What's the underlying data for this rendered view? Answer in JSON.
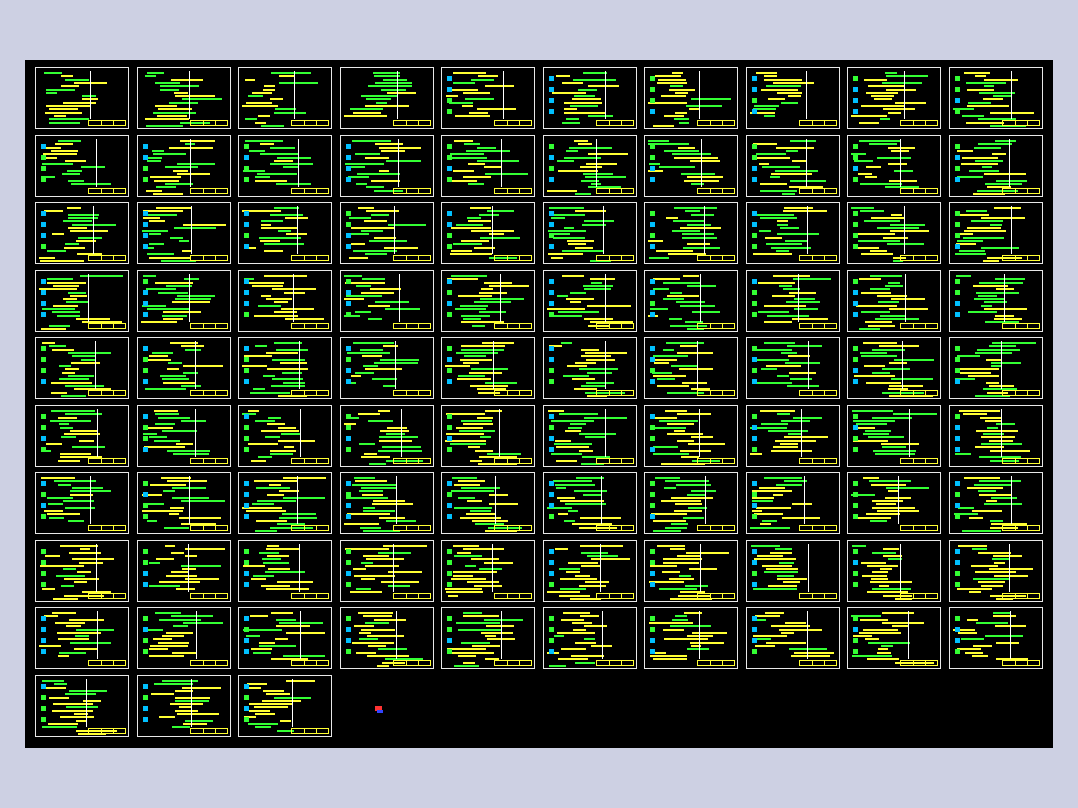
{
  "drawing": {
    "rows": 10,
    "cols": 10,
    "sheet_count": 93,
    "background_color": "#000000",
    "frame_color": "#e8e8e8",
    "palette": [
      "#ffff33",
      "#33ff33",
      "#00c0ff",
      "#ffffff",
      "#ff3333"
    ]
  }
}
